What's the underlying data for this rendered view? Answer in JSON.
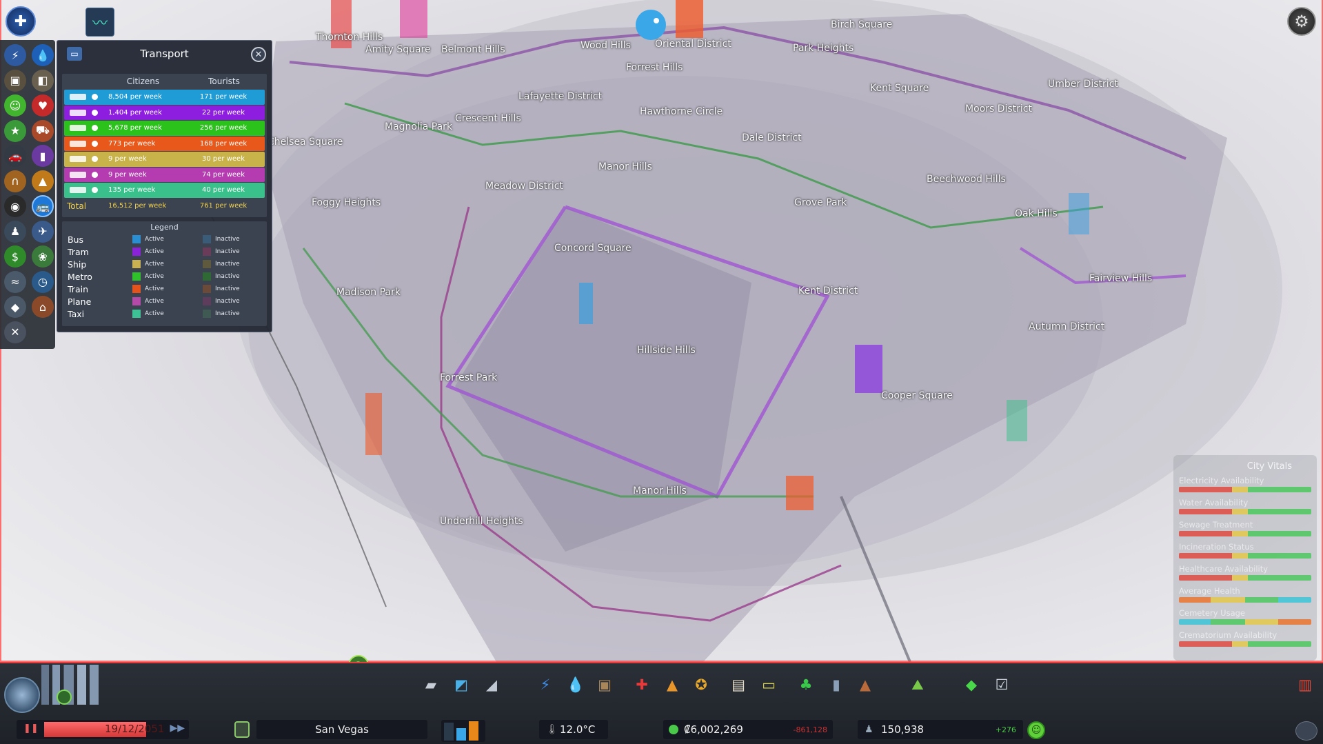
{
  "transport_panel": {
    "title": "Transport",
    "col_citizens": "Citizens",
    "col_tourists": "Tourists",
    "rows": [
      {
        "mode": "bus",
        "color": "#1f9bd6",
        "citizens": "8,504 per week",
        "tourists": "171 per week"
      },
      {
        "mode": "tram",
        "color": "#8d1ee0",
        "citizens": "1,404 per week",
        "tourists": "22 per week"
      },
      {
        "mode": "metro",
        "color": "#2cc21c",
        "citizens": "5,678 per week",
        "tourists": "256 per week"
      },
      {
        "mode": "train",
        "color": "#e8581a",
        "citizens": "773 per week",
        "tourists": "168 per week"
      },
      {
        "mode": "ship",
        "color": "#c8b24a",
        "citizens": "9 per week",
        "tourists": "30 per week"
      },
      {
        "mode": "plane",
        "color": "#b43cb0",
        "citizens": "9 per week",
        "tourists": "74 per week"
      },
      {
        "mode": "taxi",
        "color": "#3ac08a",
        "citizens": "135 per week",
        "tourists": "40 per week"
      }
    ],
    "total_label": "Total",
    "total_citizens": "16,512 per week",
    "total_tourists": "761 per week",
    "legend": {
      "title": "Legend",
      "items": [
        {
          "name": "Bus",
          "active": "Active",
          "inactive": "Inactive",
          "active_color": "#2a8fd2",
          "inactive_color": "#3b5c78"
        },
        {
          "name": "Tram",
          "active": "Active",
          "inactive": "Inactive",
          "active_color": "#8a22d8",
          "inactive_color": "#6a3c5a"
        },
        {
          "name": "Ship",
          "active": "Active",
          "inactive": "Inactive",
          "active_color": "#c9b152",
          "inactive_color": "#5f5a3e"
        },
        {
          "name": "Metro",
          "active": "Active",
          "inactive": "Inactive",
          "active_color": "#2fc22a",
          "inactive_color": "#2f6a34"
        },
        {
          "name": "Train",
          "active": "Active",
          "inactive": "Inactive",
          "active_color": "#e4531b",
          "inactive_color": "#6b4a3a"
        },
        {
          "name": "Plane",
          "active": "Active",
          "inactive": "Inactive",
          "active_color": "#b44aa8",
          "inactive_color": "#5e3c5c"
        },
        {
          "name": "Taxi",
          "active": "Active",
          "inactive": "Inactive",
          "active_color": "#3cc295",
          "inactive_color": "#3e5a52"
        }
      ]
    }
  },
  "districts": [
    {
      "name": "Thornton Hills"
    },
    {
      "name": "Amity Square"
    },
    {
      "name": "Belmont Hills"
    },
    {
      "name": "Wood Hills"
    },
    {
      "name": "Oriental District"
    },
    {
      "name": "Birch Square"
    },
    {
      "name": "Park Heights"
    },
    {
      "name": "Lafayette District"
    },
    {
      "name": "Forrest Hills"
    },
    {
      "name": "Kent Square"
    },
    {
      "name": "Umber District"
    },
    {
      "name": "Moors District"
    },
    {
      "name": "Hawthorne Circle"
    },
    {
      "name": "Magnolia Park"
    },
    {
      "name": "Crescent Hills"
    },
    {
      "name": "Dale District"
    },
    {
      "name": "Chelsea Square"
    },
    {
      "name": "Manor Hills"
    },
    {
      "name": "Beechwood Hills"
    },
    {
      "name": "Meadow District"
    },
    {
      "name": "Foggy Heights"
    },
    {
      "name": "Grove Park"
    },
    {
      "name": "Oak Hills"
    },
    {
      "name": "Concord Square"
    },
    {
      "name": "Fairview Hills"
    },
    {
      "name": "Madison Park"
    },
    {
      "name": "Kent District"
    },
    {
      "name": "Autumn District"
    },
    {
      "name": "Hillside Hills"
    },
    {
      "name": "Forrest Park"
    },
    {
      "name": "Cooper Square"
    },
    {
      "name": "Manor Hills"
    },
    {
      "name": "Underhill Heights"
    }
  ],
  "city_vitals": {
    "title": "City Vitals",
    "items": [
      {
        "label": "Electricity Availability"
      },
      {
        "label": "Water Availability"
      },
      {
        "label": "Sewage Treatment"
      },
      {
        "label": "Incineration Status"
      },
      {
        "label": "Healthcare Availability"
      },
      {
        "label": "Average Health"
      },
      {
        "label": "Cemetery Usage"
      },
      {
        "label": "Crematorium Availability"
      }
    ]
  },
  "status_bar": {
    "date": "19/12/2051",
    "city_name": "San Vegas",
    "temperature": "12.0°C",
    "money": "₡6,002,269",
    "money_change": "-861,128",
    "population": "150,938",
    "population_change": "+276"
  },
  "help": {
    "label": "?"
  },
  "icons": {
    "menu": "chirper-menu-icon",
    "info_views": "info-views-icon",
    "settings": "gear-icon",
    "unlock": "milestones-icon"
  }
}
